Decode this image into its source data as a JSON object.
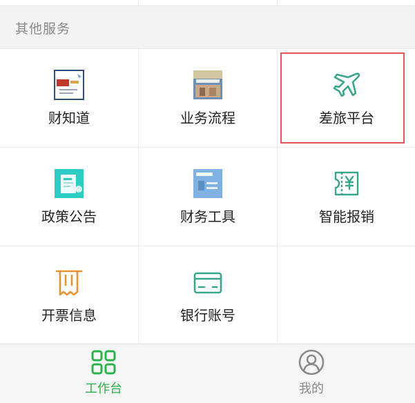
{
  "section": {
    "title": "其他服务"
  },
  "services": [
    {
      "label": "财知道",
      "icon": "finance-knowledge-thumbnail-icon"
    },
    {
      "label": "业务流程",
      "icon": "business-process-thumbnail-icon"
    },
    {
      "label": "差旅平台",
      "icon": "airplane-icon"
    },
    {
      "label": "政策公告",
      "icon": "policy-announcement-thumbnail-icon"
    },
    {
      "label": "财务工具",
      "icon": "finance-tools-thumbnail-icon"
    },
    {
      "label": "智能报销",
      "icon": "yen-ticket-icon"
    },
    {
      "label": "开票信息",
      "icon": "receipt-icon"
    },
    {
      "label": "银行账号",
      "icon": "bank-card-icon"
    }
  ],
  "tabbar": {
    "workbench": {
      "label": "工作台",
      "icon": "grid-icon",
      "active": true
    },
    "mine": {
      "label": "我的",
      "icon": "user-circle-icon",
      "active": false
    }
  },
  "colors": {
    "accent_green": "#2bb24c",
    "icon_teal": "#3aa58c",
    "icon_orange": "#e8912e",
    "highlight_red": "#e8545c",
    "tab_inactive": "#8a8a8a"
  }
}
